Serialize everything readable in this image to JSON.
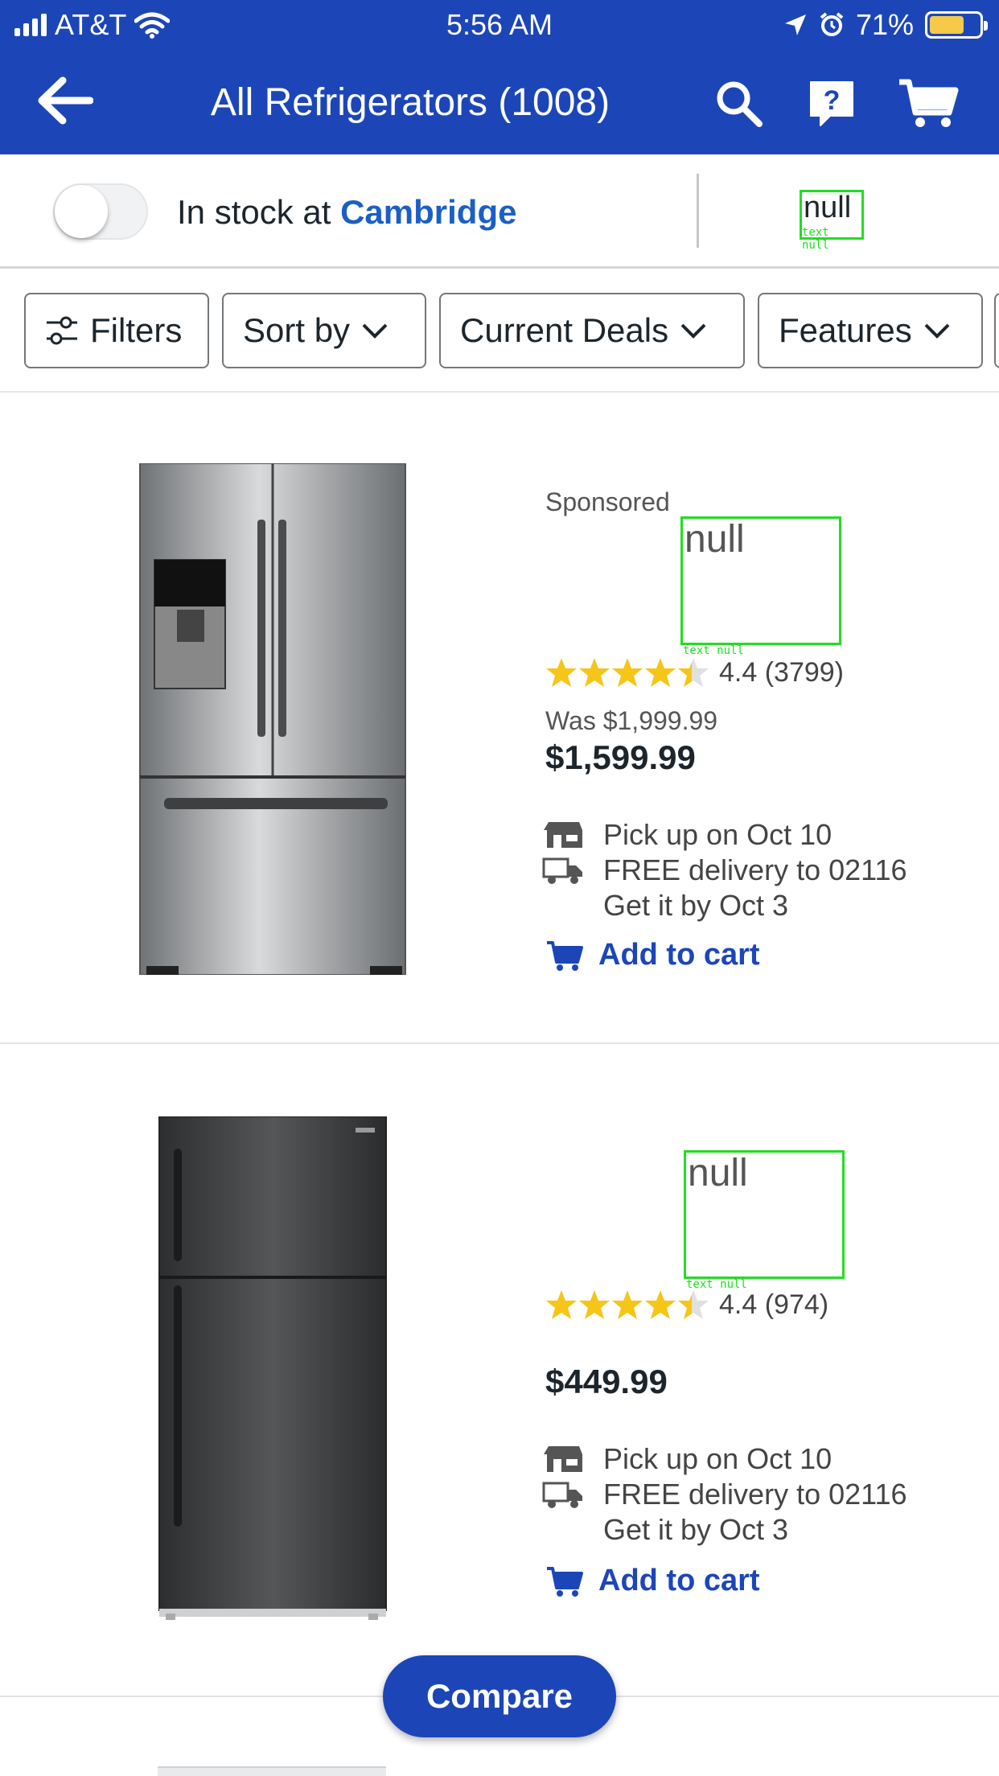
{
  "status": {
    "carrier": "AT&T",
    "time": "5:56 AM",
    "battery": "71%"
  },
  "header": {
    "title": "All Refrigerators (1008)"
  },
  "stock": {
    "prefix": "In stock at",
    "store": "Cambridge",
    "placeholder": "null",
    "placeholder_tag": "text null"
  },
  "chips": [
    {
      "label": "Filters"
    },
    {
      "label": "Sort by"
    },
    {
      "label": "Current Deals"
    },
    {
      "label": "Features"
    }
  ],
  "products": [
    {
      "sponsored": "Sponsored",
      "title": "null",
      "title_tag": "text null",
      "rating": "4.4 (3799)",
      "stars": 4.4,
      "was": "Was $1,999.99",
      "price": "$1,599.99",
      "pickup": "Pick up on Oct 10",
      "delivery": "FREE delivery to 02116",
      "delivery_date": "Get it by Oct 3",
      "add_to_cart": "Add to cart"
    },
    {
      "title": "null",
      "title_tag": "text null",
      "rating": "4.4 (974)",
      "stars": 4.4,
      "price": "$449.99",
      "pickup": "Pick up on Oct 10",
      "delivery": "FREE delivery to 02116",
      "delivery_date": "Get it by Oct 3",
      "add_to_cart": "Add to cart"
    }
  ],
  "compare": {
    "label": "Compare"
  },
  "colors": {
    "brand": "#1c46b8",
    "link": "#1c5fc4",
    "star": "#f5c518",
    "annotation": "#22dd22"
  }
}
